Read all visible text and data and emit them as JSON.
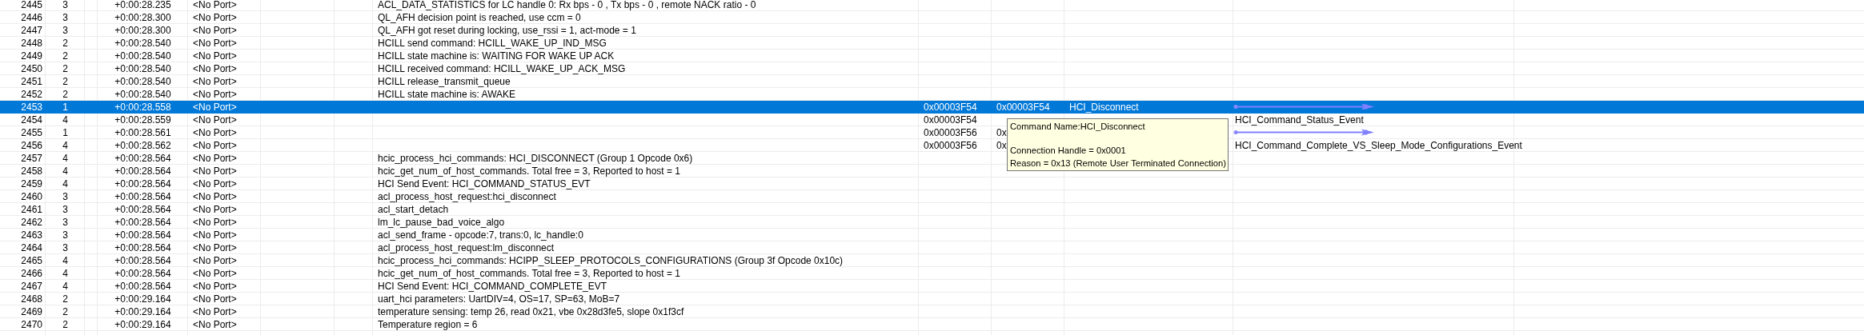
{
  "rows": [
    {
      "index": "2445",
      "level": "3",
      "time": "+0:00:28.235",
      "port": "<No Port>",
      "message": "ACL_DATA_STATISTICS for LC handle 0: Rx bps - 0 , Tx bps - 0 , remote NACK ratio - 0",
      "selected": false
    },
    {
      "index": "2446",
      "level": "3",
      "time": "+0:00:28.300",
      "port": "<No Port>",
      "message": "QL_AFH decision point is reached, use ccm = 0",
      "selected": false
    },
    {
      "index": "2447",
      "level": "3",
      "time": "+0:00:28.300",
      "port": "<No Port>",
      "message": "QL_AFH got reset during locking, use_rssi = 1, act-mode = 1",
      "selected": false
    },
    {
      "index": "2448",
      "level": "2",
      "time": "+0:00:28.540",
      "port": "<No Port>",
      "message": "HCILL send command: HCILL_WAKE_UP_IND_MSG",
      "selected": false
    },
    {
      "index": "2449",
      "level": "2",
      "time": "+0:00:28.540",
      "port": "<No Port>",
      "message": "HCILL state machine is: WAITING FOR WAKE UP ACK",
      "selected": false
    },
    {
      "index": "2450",
      "level": "2",
      "time": "+0:00:28.540",
      "port": "<No Port>",
      "message": "HCILL received command: HCILL_WAKE_UP_ACK_MSG",
      "selected": false
    },
    {
      "index": "2451",
      "level": "2",
      "time": "+0:00:28.540",
      "port": "<No Port>",
      "message": "HCILL release_transmit_queue",
      "selected": false
    },
    {
      "index": "2452",
      "level": "2",
      "time": "+0:00:28.540",
      "port": "<No Port>",
      "message": "HCILL state machine is: AWAKE",
      "selected": false
    },
    {
      "index": "2453",
      "level": "1",
      "time": "+0:00:28.558",
      "port": "<No Port>",
      "address_1": "0x00003F54",
      "address_2": "0x00003F54",
      "command": "HCI_Disconnect",
      "arrow": true,
      "selected": true
    },
    {
      "index": "2454",
      "level": "4",
      "time": "+0:00:28.559",
      "port": "<No Port>",
      "address_1": "0x00003F54",
      "event": "HCI_Command_Status_Event",
      "selected": false
    },
    {
      "index": "2455",
      "level": "1",
      "time": "+0:00:28.561",
      "port": "<No Port>",
      "address_1": "0x00003F56",
      "address_2": "0x",
      "arrow": true,
      "selected": false
    },
    {
      "index": "2456",
      "level": "4",
      "time": "+0:00:28.562",
      "port": "<No Port>",
      "address_1": "0x00003F56",
      "address_2": "0x",
      "event": "HCI_Command_Complete_VS_Sleep_Mode_Configurations_Event",
      "selected": false
    },
    {
      "index": "2457",
      "level": "4",
      "time": "+0:00:28.564",
      "port": "<No Port>",
      "message": "hcic_process_hci_commands: HCI_DISCONNECT (Group 1 Opcode 0x6)",
      "selected": false
    },
    {
      "index": "2458",
      "level": "4",
      "time": "+0:00:28.564",
      "port": "<No Port>",
      "message": "hcic_get_num_of_host_commands. Total free = 3, Reported to host = 1",
      "selected": false
    },
    {
      "index": "2459",
      "level": "4",
      "time": "+0:00:28.564",
      "port": "<No Port>",
      "message": "HCI Send Event: HCI_COMMAND_STATUS_EVT",
      "selected": false
    },
    {
      "index": "2460",
      "level": "3",
      "time": "+0:00:28.564",
      "port": "<No Port>",
      "message": "acl_process_host_request:hci_disconnect",
      "selected": false
    },
    {
      "index": "2461",
      "level": "3",
      "time": "+0:00:28.564",
      "port": "<No Port>",
      "message": "acl_start_detach",
      "selected": false
    },
    {
      "index": "2462",
      "level": "3",
      "time": "+0:00:28.564",
      "port": "<No Port>",
      "message": "lm_lc_pause_bad_voice_algo",
      "selected": false
    },
    {
      "index": "2463",
      "level": "3",
      "time": "+0:00:28.564",
      "port": "<No Port>",
      "message": "acl_send_frame - opcode:7, trans:0, lc_handle:0",
      "selected": false
    },
    {
      "index": "2464",
      "level": "3",
      "time": "+0:00:28.564",
      "port": "<No Port>",
      "message": "acl_process_host_request:lm_disconnect",
      "selected": false
    },
    {
      "index": "2465",
      "level": "4",
      "time": "+0:00:28.564",
      "port": "<No Port>",
      "message": "hcic_process_hci_commands: HCIPP_SLEEP_PROTOCOLS_CONFIGURATIONS (Group 3f Opcode 0x10c)",
      "selected": false
    },
    {
      "index": "2466",
      "level": "4",
      "time": "+0:00:28.564",
      "port": "<No Port>",
      "message": "hcic_get_num_of_host_commands. Total free = 3, Reported to host = 1",
      "selected": false
    },
    {
      "index": "2467",
      "level": "4",
      "time": "+0:00:28.564",
      "port": "<No Port>",
      "message": "HCI Send Event: HCI_COMMAND_COMPLETE_EVT",
      "selected": false
    },
    {
      "index": "2468",
      "level": "2",
      "time": "+0:00:29.164",
      "port": "<No Port>",
      "message": "uart_hci parameters: UartDIV=4, OS=17, SP=63, MoB=7",
      "selected": false
    },
    {
      "index": "2469",
      "level": "2",
      "time": "+0:00:29.164",
      "port": "<No Port>",
      "message": "temperature sensing: temp 26, read 0x21, vbe 0x28d3fe5, slope 0x1f3cf",
      "selected": false
    },
    {
      "index": "2470",
      "level": "2",
      "time": "+0:00:29.164",
      "port": "<No Port>",
      "message": "Temperature region = 6",
      "selected": false
    }
  ],
  "tooltip": {
    "lines": [
      "Command Name:HCI_Disconnect",
      "Connection Handle = 0x0001",
      "Reason = 0x13 (Remote User Terminated Connection)"
    ]
  }
}
